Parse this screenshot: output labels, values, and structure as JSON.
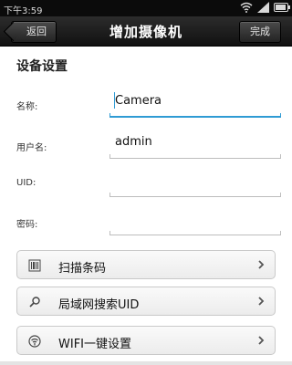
{
  "status_bar": {
    "time": "下午3:59"
  },
  "header": {
    "title": "增加摄像机",
    "back_label": "返回",
    "done_label": "完成"
  },
  "section": {
    "title": "设备设置"
  },
  "form": {
    "name": {
      "label": "名称:",
      "value": "Camera"
    },
    "username": {
      "label": "用户名:",
      "value": "admin"
    },
    "uid": {
      "label": "UID:",
      "value": ""
    },
    "password": {
      "label": "密码:",
      "value": ""
    }
  },
  "actions": {
    "scan": {
      "label": "扫描条码",
      "icon": "barcode-icon"
    },
    "lan_search": {
      "label": "局域网搜索UID",
      "icon": "search-icon"
    },
    "wifi_setup": {
      "label": "WIFI一键设置",
      "icon": "wifi-setup-icon"
    }
  }
}
